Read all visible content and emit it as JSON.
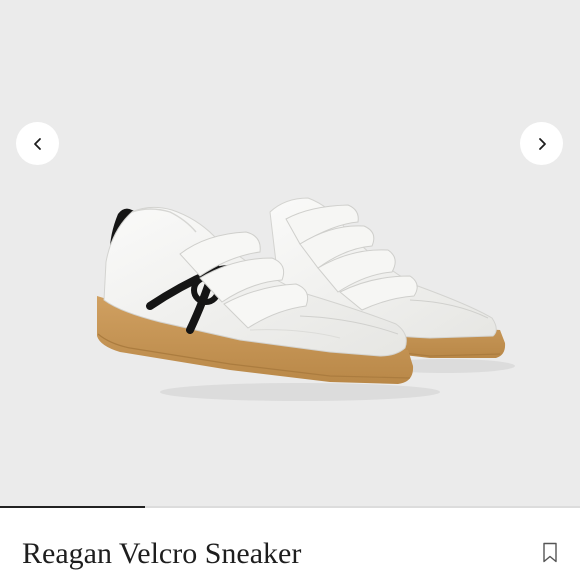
{
  "gallery": {
    "image_alt": "Reagan Velcro Sneaker",
    "prev_icon": "chevron-left-icon",
    "next_icon": "chevron-right-icon",
    "progress": 0.25
  },
  "product": {
    "title": "Reagan Velcro Sneaker",
    "bookmark_icon": "bookmark-icon"
  },
  "colors": {
    "gallery_background": "#ebebeb",
    "shoe_upper": "#f4f4f2",
    "gum_sole": "#c69657",
    "accent_black": "#151515",
    "title_text": "#1e1e1e"
  }
}
